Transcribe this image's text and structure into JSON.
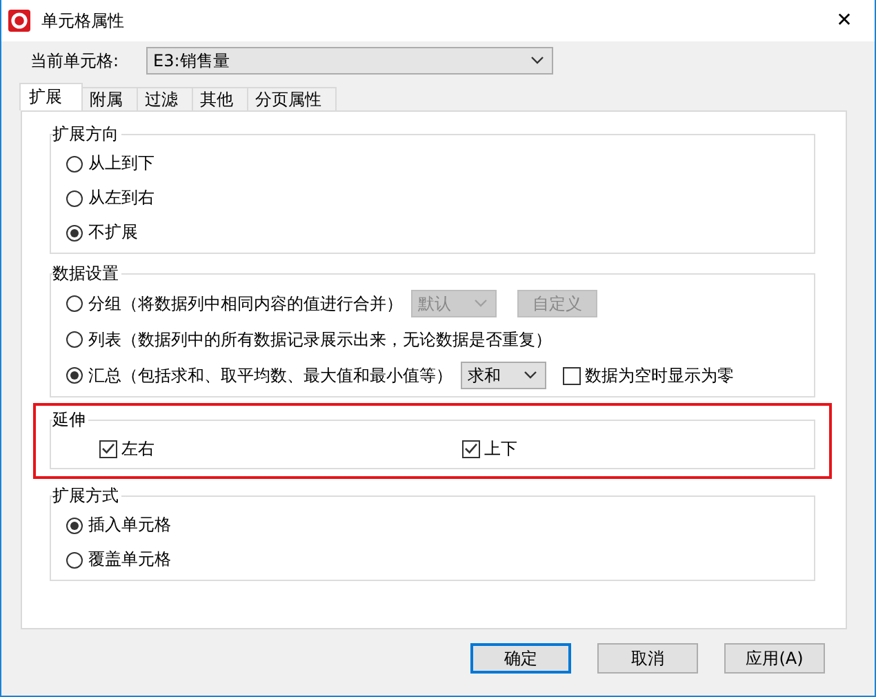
{
  "window": {
    "title": "单元格属性",
    "close": "✕"
  },
  "current_cell": {
    "label": "当前单元格:",
    "value": "E3:销售量"
  },
  "tabs": [
    {
      "label": "扩展",
      "selected": true
    },
    {
      "label": "附属",
      "selected": false
    },
    {
      "label": "过滤",
      "selected": false
    },
    {
      "label": "其他",
      "selected": false
    },
    {
      "label": "分页属性",
      "selected": false
    }
  ],
  "groups": [
    {
      "title": "扩展方向",
      "kind": "radio",
      "highlighted": false,
      "items": [
        {
          "label": "从上到下",
          "selected": false
        },
        {
          "label": "从左到右",
          "selected": false
        },
        {
          "label": "不扩展",
          "selected": true
        }
      ]
    },
    {
      "title": "数据设置",
      "kind": "radio",
      "highlighted": false,
      "items": [
        {
          "label": "分组（将数据列中相同内容的值进行合并）",
          "selected": false,
          "dropdown": {
            "value": "默认",
            "disabled": true
          },
          "button": {
            "label": "自定义",
            "disabled": true
          }
        },
        {
          "label": "列表（数据列中的所有数据记录展示出来，无论数据是否重复）",
          "selected": false
        },
        {
          "label": "汇总（包括求和、取平均数、最大值和最小值等）",
          "selected": true,
          "dropdown": {
            "value": "求和",
            "disabled": false
          },
          "checkbox": {
            "label": "数据为空时显示为零",
            "checked": false
          }
        }
      ]
    },
    {
      "title": "延伸",
      "kind": "check",
      "highlighted": true,
      "items": [
        {
          "label": "左右",
          "checked": true
        },
        {
          "label": "上下",
          "checked": true
        }
      ]
    },
    {
      "title": "扩展方式",
      "kind": "radio",
      "highlighted": false,
      "items": [
        {
          "label": "插入单元格",
          "selected": true
        },
        {
          "label": "覆盖单元格",
          "selected": false
        }
      ]
    }
  ],
  "buttons": [
    {
      "label": "确定",
      "default": true
    },
    {
      "label": "取消",
      "default": false
    },
    {
      "label": "应用(A)",
      "default": false
    }
  ]
}
